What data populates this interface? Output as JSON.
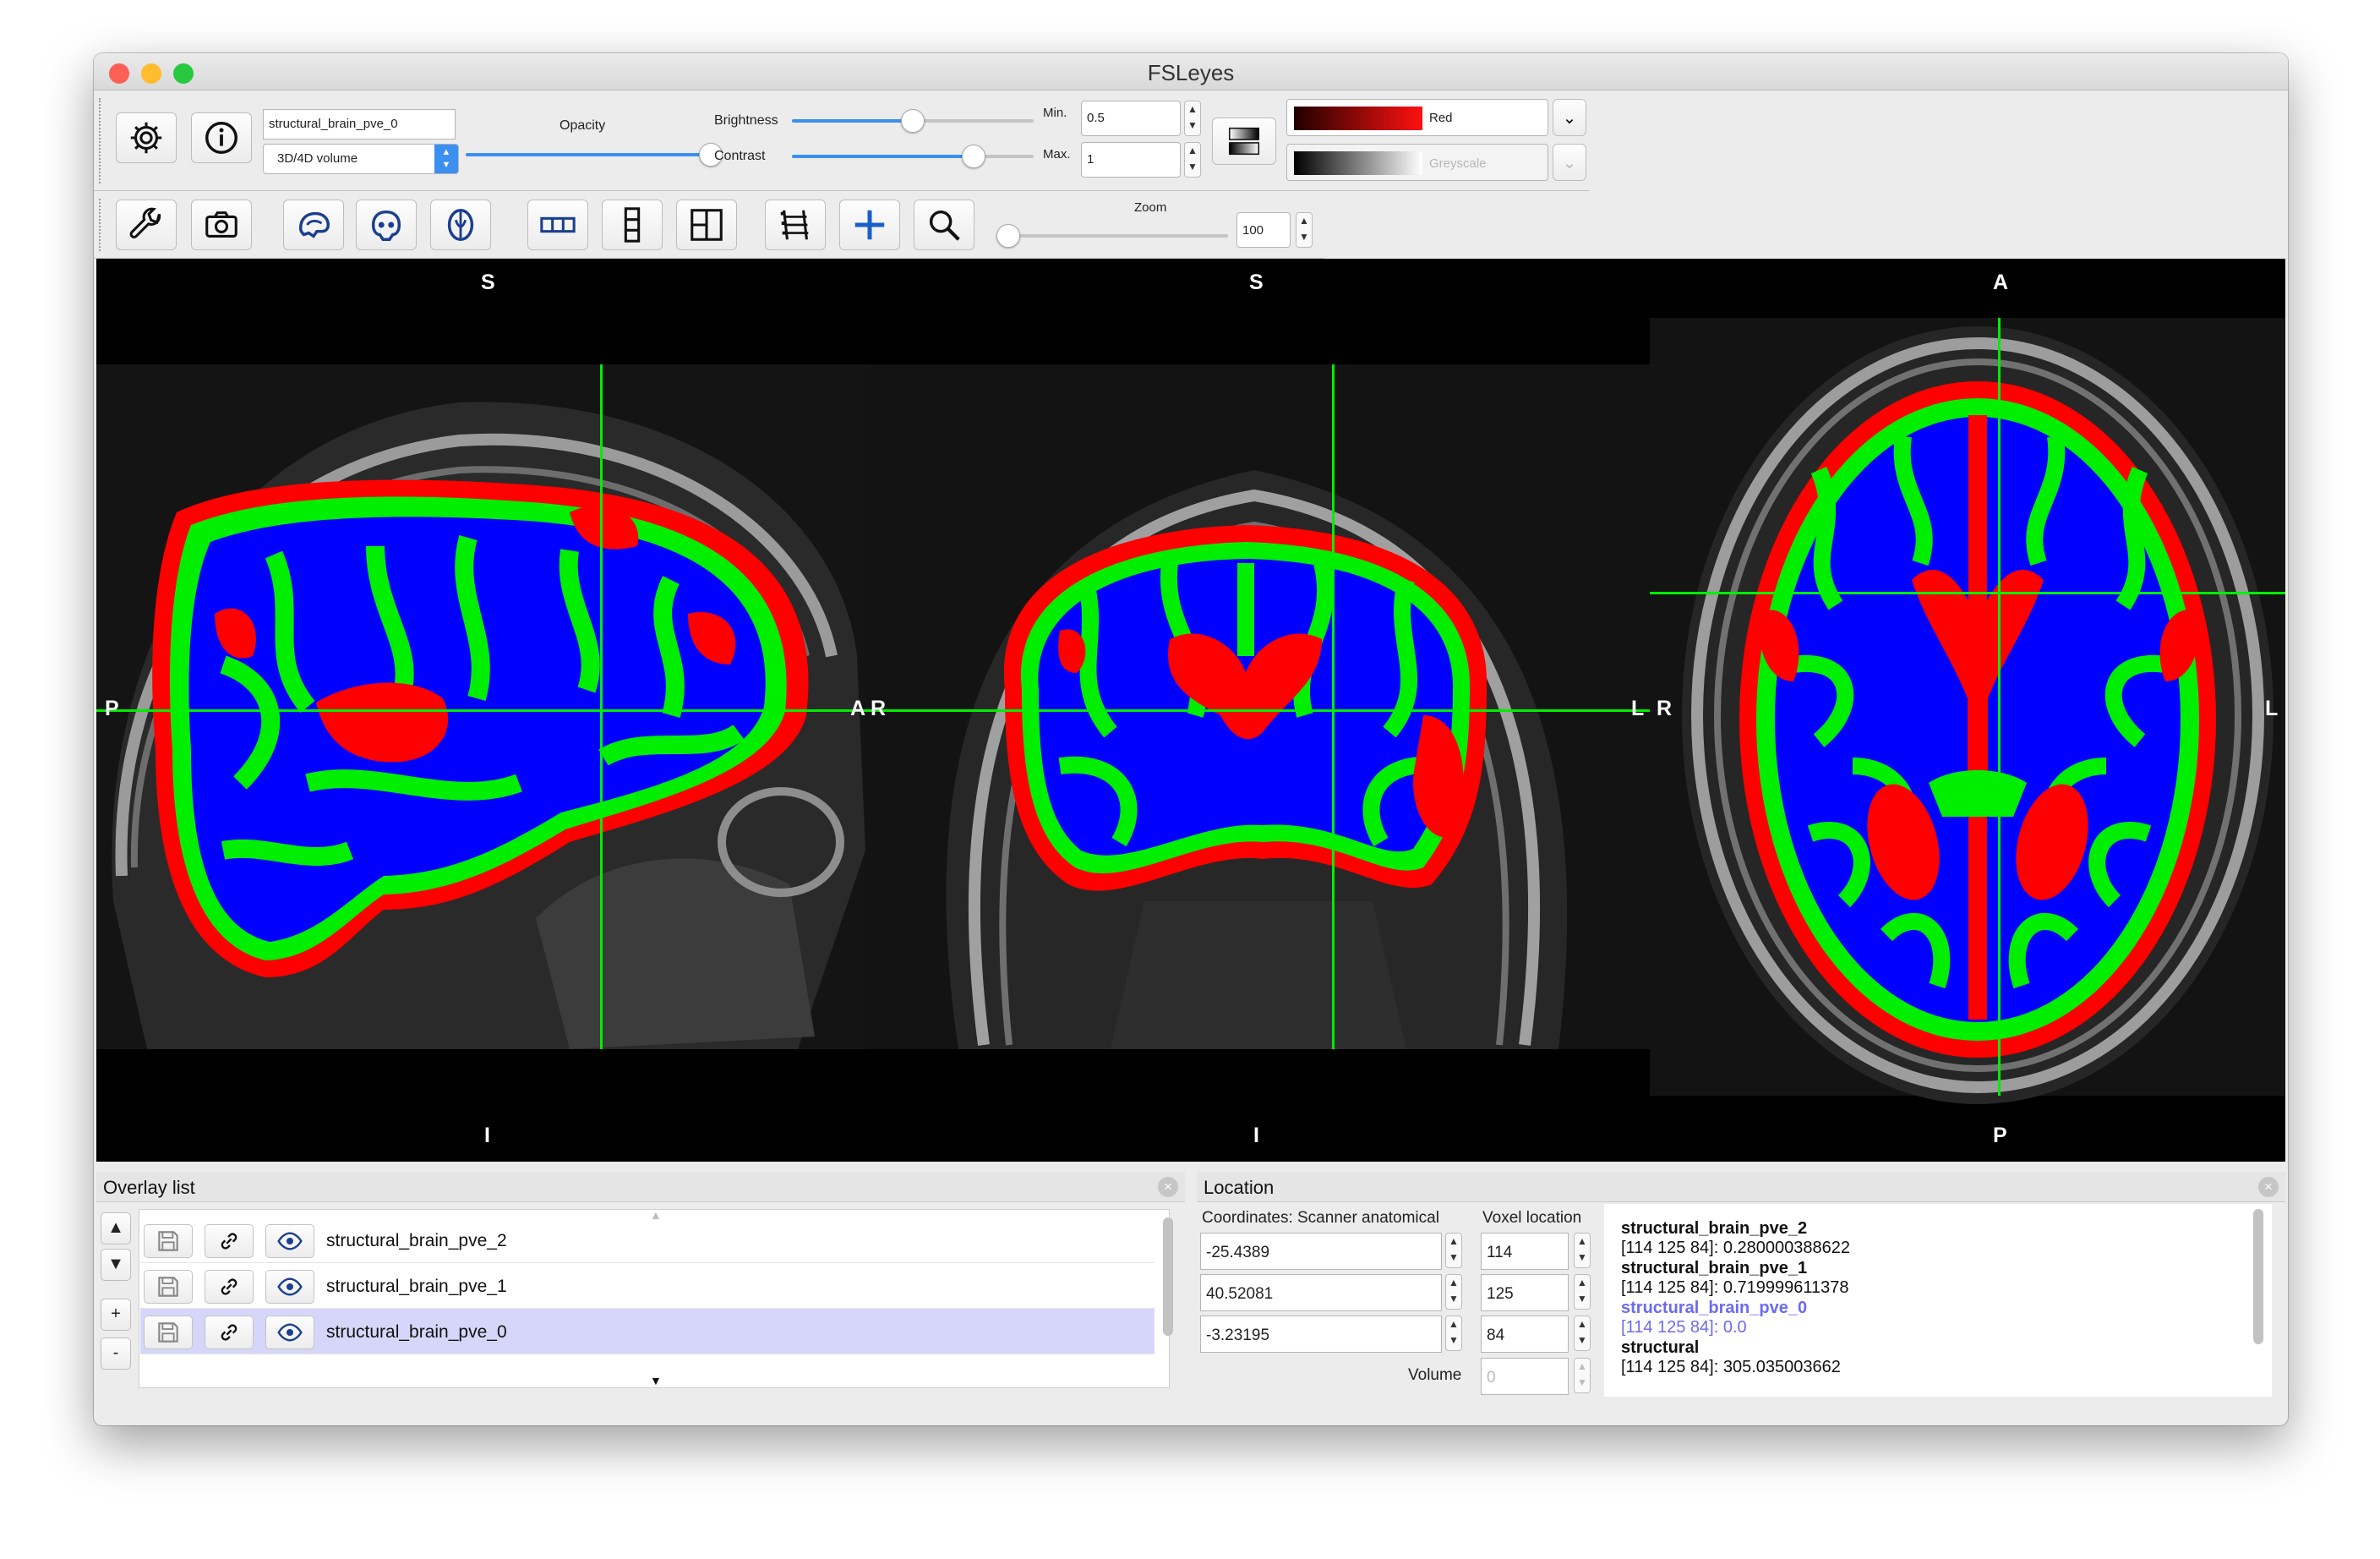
{
  "window": {
    "title": "FSLeyes"
  },
  "colors": {
    "close": "#fe5f57",
    "minimize": "#febc2e",
    "zoom": "#28c840",
    "crosshair": "#00ee00",
    "wm": "#0000ff",
    "gm": "#00ee00",
    "csf": "#ff0000",
    "selected_row": "#d6d6fa",
    "selected_text": "#6b6bf0"
  },
  "toolbar": {
    "overlay_name": "structural_brain_pve_0",
    "overlay_type": "3D/4D volume",
    "opacity_label": "Opacity",
    "opacity_value": 1.0,
    "brightness_label": "Brightness",
    "brightness_value": 0.5,
    "contrast_label": "Contrast",
    "contrast_value": 0.75,
    "min_label": "Min.",
    "min_value": "0.5",
    "max_label": "Max.",
    "max_value": "1",
    "cmap1": "Red",
    "cmap2": "Greyscale",
    "zoom_label": "Zoom",
    "zoom_value": "100",
    "zoom_fraction": 0.0
  },
  "icons": {
    "settings": "gear-icon",
    "info": "info-icon",
    "tool": "wrench-icon",
    "screenshot": "camera-icon",
    "sagittal": "sagittal-brain-icon",
    "coronal": "coronal-brain-icon",
    "axial": "axial-brain-icon",
    "horizontal": "horizontal-layout-icon",
    "vertical": "vertical-layout-icon",
    "grid": "grid-layout-icon",
    "movie": "film-icon",
    "crosshair": "crosshair-icon",
    "zoom": "magnifier-icon"
  },
  "views": {
    "sagittal": {
      "top": "S",
      "bottom": "I",
      "left": "P",
      "right": "A"
    },
    "coronal": {
      "top": "S",
      "bottom": "I",
      "left": "R",
      "right": "L"
    },
    "axial": {
      "top": "A",
      "bottom": "P",
      "left": "R",
      "right": "L"
    }
  },
  "overlay_list": {
    "title": "Overlay list",
    "items": [
      {
        "name": "structural_brain_pve_2",
        "selected": false
      },
      {
        "name": "structural_brain_pve_1",
        "selected": false
      },
      {
        "name": "structural_brain_pve_0",
        "selected": true
      }
    ],
    "buttons": [
      "▲",
      "▼",
      "+",
      "-"
    ]
  },
  "location": {
    "title": "Location",
    "coords_header": "Coordinates: Scanner anatomical",
    "voxel_header": "Voxel location",
    "coords": [
      "-25.4389",
      "40.52081",
      "-3.23195"
    ],
    "voxels": [
      "114",
      "125",
      "84"
    ],
    "volume_label": "Volume",
    "volume_value": "0",
    "info": [
      {
        "name": "structural_brain_pve_2",
        "value": "[114 125 84]: 0.280000388622",
        "selected": false
      },
      {
        "name": "structural_brain_pve_1",
        "value": "[114 125 84]: 0.719999611378",
        "selected": false
      },
      {
        "name": "structural_brain_pve_0",
        "value": "[114 125 84]: 0.0",
        "selected": true
      },
      {
        "name": "structural",
        "value": "[114 125 84]: 305.035003662",
        "selected": false
      }
    ]
  }
}
